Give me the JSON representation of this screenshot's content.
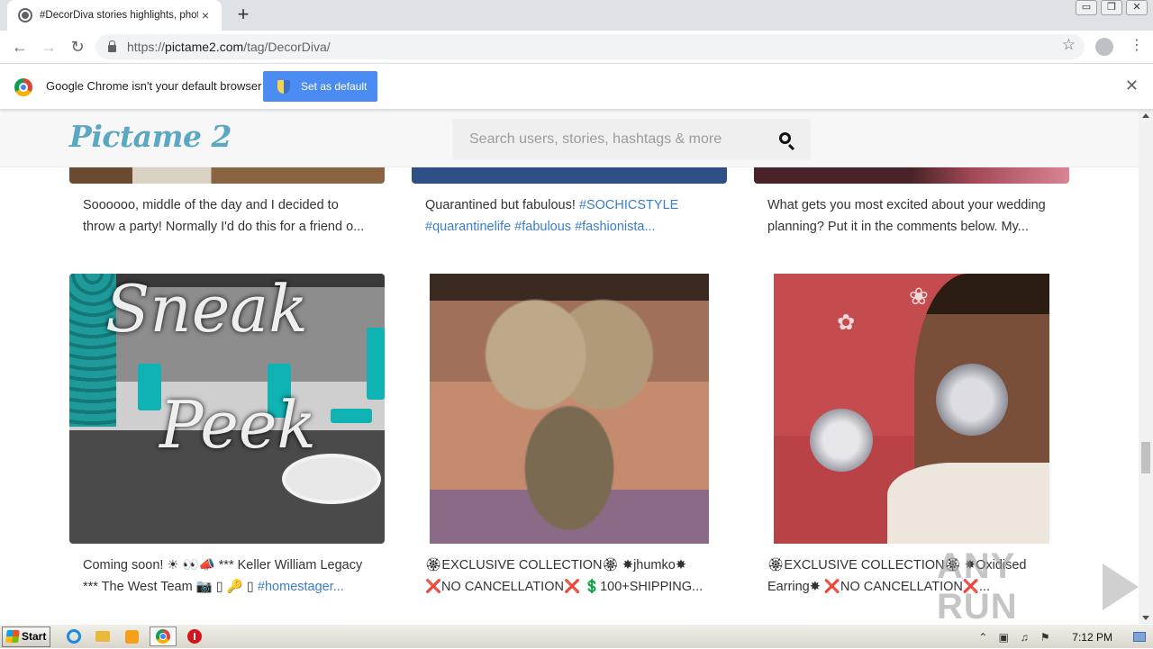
{
  "browser": {
    "tab": {
      "title": "#DecorDiva stories highlights, photo",
      "close": "×"
    },
    "new_tab": "+",
    "window_buttons": {
      "minimize": "▭",
      "restore": "❐",
      "close": "✕"
    },
    "nav": {
      "back": "←",
      "forward": "→",
      "reload": "↻"
    },
    "address": {
      "scheme": "https://",
      "host": "pictame2.com",
      "path": "/tag/DecorDiva/"
    },
    "star": "☆",
    "menu": "⋮",
    "infobar": {
      "message": "Google Chrome isn't your default browser",
      "button": "Set as default",
      "close": "✕"
    }
  },
  "site": {
    "logo": "Pictame 2",
    "search_placeholder": "Search users, stories, hashtags & more",
    "posts_top": [
      {
        "caption": "Soooooo, middle of the day and I decided to throw a party! Normally I'd do this for a friend o...",
        "tags": ""
      },
      {
        "caption": "Quarantined but fabulous! ",
        "tags": "#SOCHICSTYLE #quarantinelife #fabulous #fashionista..."
      },
      {
        "caption": "What gets you most excited about your wedding planning? Put it in the comments below. My...",
        "tags": ""
      }
    ],
    "posts_bottom": [
      {
        "caption": "Coming soon! ☀ 👀📣 *** Keller William Legacy *** The West Team 📷 ▯ 🔑 ▯ ",
        "tags": "#homestager...",
        "image_text_1": "Sneak",
        "image_text_2": "Peek"
      },
      {
        "caption": "🏵EXCLUSIVE COLLECTION🏵 ✸jhumko✸ ❌NO CANCELLATION❌ 💲100+SHIPPING...",
        "tags": ""
      },
      {
        "caption": "🏵EXCLUSIVE COLLECTION🏵 ✸Oxidised Earring✸ ❌NO CANCELLATION❌...",
        "tags": ""
      }
    ]
  },
  "watermark": {
    "text": "ANY RUN"
  },
  "taskbar": {
    "start": "Start",
    "clock": "7:12 PM",
    "tray_up": "⌃"
  },
  "icons": {
    "tab_favicon": "pictame-favicon-icon",
    "lock": "lock-icon",
    "search": "search-icon",
    "shield": "uac-shield-icon"
  }
}
